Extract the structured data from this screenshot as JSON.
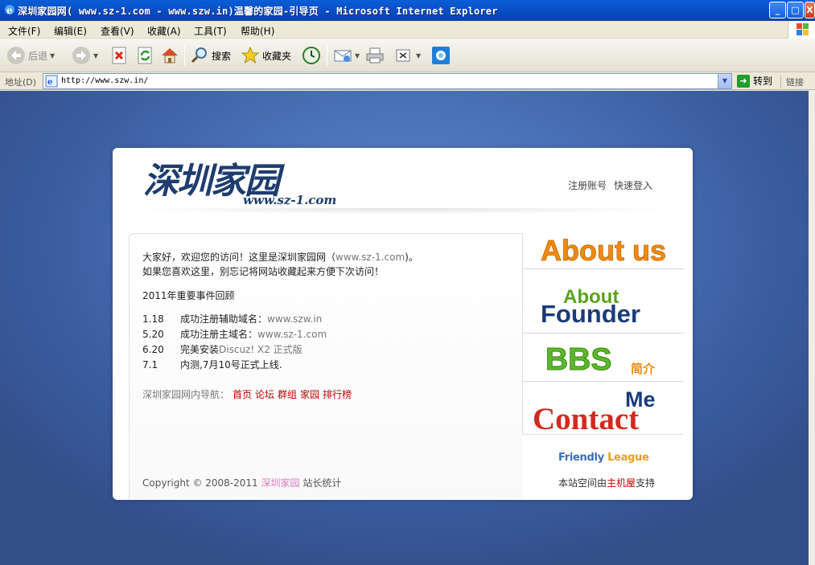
{
  "window": {
    "title": "深圳家园网( www.sz-1.com - www.szw.in)温馨的家园-引导页 - Microsoft Internet Explorer",
    "min": "_",
    "max": "□",
    "close": "X"
  },
  "menu": [
    "文件(F)",
    "编辑(E)",
    "查看(V)",
    "收藏(A)",
    "工具(T)",
    "帮助(H)"
  ],
  "toolbar": {
    "back": "后退",
    "search": "搜索",
    "favorites": "收藏夹"
  },
  "address": {
    "label": "地址(D)",
    "url": "http://www.szw.in/",
    "go": "转到",
    "links": "链接"
  },
  "page": {
    "logo_text": "深圳家园",
    "logo_url": "www.sz-1.com",
    "top_links": [
      "注册账号",
      "快速登入"
    ],
    "welcome_line1_a": "大家好，欢迎您的访问！这里是深圳家园网（",
    "welcome_line1_site": "www.sz-1.com",
    "welcome_line1_b": ")。",
    "welcome_line2": "如果您喜欢这里，别忘记将网站收藏起来方便下次访问！",
    "events_title": "2011年重要事件回顾",
    "events": [
      {
        "date": "1.18",
        "text_a": "成功注册辅助域名：",
        "text_b": "www.szw.in"
      },
      {
        "date": "5.20",
        "text_a": "成功注册主域名：",
        "text_b": "www.sz-1.com"
      },
      {
        "date": "6.20",
        "text_a": "完美安装",
        "text_b": "Discuz! X2 正式版"
      },
      {
        "date": "7.1",
        "text_a": "内测,7月10号正式上线.",
        "text_b": ""
      }
    ],
    "nav_label": "深圳家园网内导航：",
    "nav_links": [
      "首页",
      "论坛",
      "群组",
      "家园",
      "排行榜"
    ],
    "copyright_a": "Copyright © 2008-2011",
    "copyright_brand": "深圳家园",
    "copyright_b": "站长统计",
    "sidebar": {
      "about_us": "About us",
      "about": "About",
      "founder": "Founder",
      "bbs": "BBS",
      "bbs_sub": "简介",
      "me": "Me",
      "contact": "Contact"
    },
    "friendly_a": "Friendly",
    "friendly_b": "League",
    "hosting_a": "本站空间由",
    "hosting_h": "主机屋",
    "hosting_b": "支持"
  }
}
